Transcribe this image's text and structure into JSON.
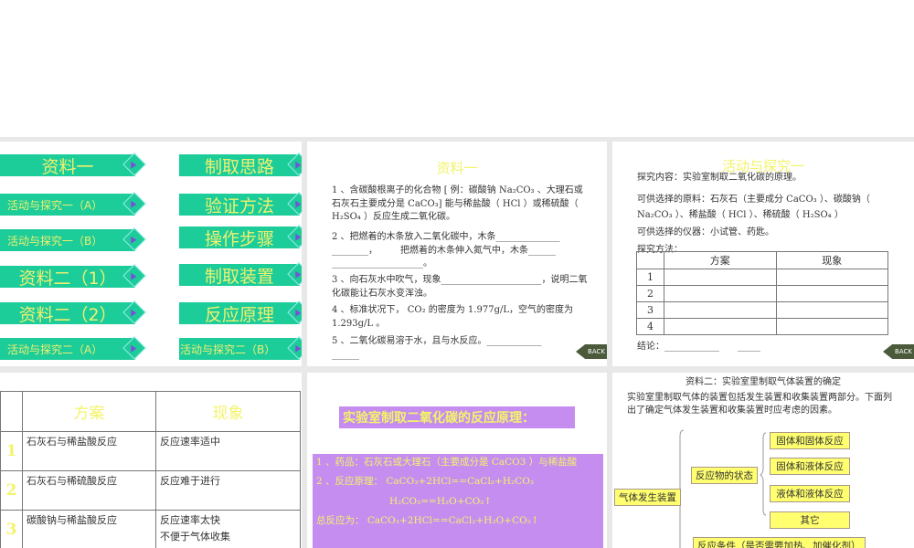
{
  "slide1": {
    "buttons": [
      "资料一",
      "活动与探究一（A）",
      "活动与探究一（B）",
      "资料二（1）",
      "资料二（2）",
      "活动与探究二（A）"
    ],
    "buttons_right": [
      "制取思路",
      "验证方法",
      "操作步骤",
      "制取装置",
      "反应原理",
      "活动与探究二（B）"
    ]
  },
  "slide2": {
    "title": "资料一",
    "p1": "1 、含碳酸根离子的化合物 [ 例：碳酸钠 Na₂CO₃ 、大理石或石灰石主要成分是 CaCO₃] 能与稀盐酸（ HCl ）或稀硫酸（ H₂SO₄ ）反应生成二氧化碳。",
    "p2": "2 、把燃着的木条放入二氧化碳中，木条______________ ________，　　　把燃着的木条伸入氮气中，木条______ ____________________。",
    "p3": "3 、向石灰水中吹气，现象______________________，说明二氧化碳能让石灰水变浑浊。",
    "p4": "4 、标准状况下， CO₂ 的密度为 1.977g/L，空气的密度为 1.293g/L 。",
    "p5": "5 、二氧化碳易溶于水，且与水反应。____________ ______",
    "back": "BACK"
  },
  "slide3": {
    "title": "活动与探究一",
    "l1": "探究内容：实验室制取二氧化碳的原理。",
    "l2": "可供选择的原料：石灰石（主要成分 CaCO₃ ）、碳酸钠（ Na₂CO₃ ）、稀盐酸（ HCl ）、稀硫酸（ H₂SO₄ ）",
    "l3": "可供选择的仪器：小试管、药匙。",
    "l4": "探究方法：",
    "headers": [
      "方案",
      "现象"
    ],
    "rows": [
      "1",
      "2",
      "3",
      "4"
    ],
    "conclusion": "结论：____________　　_____",
    "back": "BACK"
  },
  "slide4": {
    "headers": [
      "方案",
      "现象"
    ],
    "rows": [
      {
        "n": "1",
        "plan": "石灰石与稀盐酸反应",
        "result": "反应速率适中"
      },
      {
        "n": "2",
        "plan": "石灰石与稀硫酸反应",
        "result": "反应难于进行"
      },
      {
        "n": "3",
        "plan": "碳酸钠与稀盐酸反应",
        "result": "反应速率太快\n不便于气体收集"
      }
    ]
  },
  "slide5": {
    "title": "实验室制取二氧化碳的反应原理：",
    "l1": "1 、药品：石灰石或大理石（主要成分是 CaCO3 ）与稀盐酸",
    "l2": "2 、反应原理： CaCO₃+2HCl==CaCl₂+H₂CO₃",
    "l3": "H₂CO₃==H₂O+CO₂↑",
    "l4": "总反应为： CaCO₃+2HCl==CaCl₂+H₂O+CO₂↑"
  },
  "slide6": {
    "title": "资料二：实验室里制取气体装置的确定",
    "intro": "实验室里制取气体的装置包括发生装置和收集装置两部分。下面列出了确定气体发生装置和收集装置时应考虑的因素。",
    "root": "气体发生装置",
    "state": "反应物的状态",
    "states": [
      "固体和固体反应",
      "固体和液体反应",
      "液体和液体反应",
      "其它"
    ],
    "cond": "反应条件（是否需要加热、加催化剂）"
  }
}
